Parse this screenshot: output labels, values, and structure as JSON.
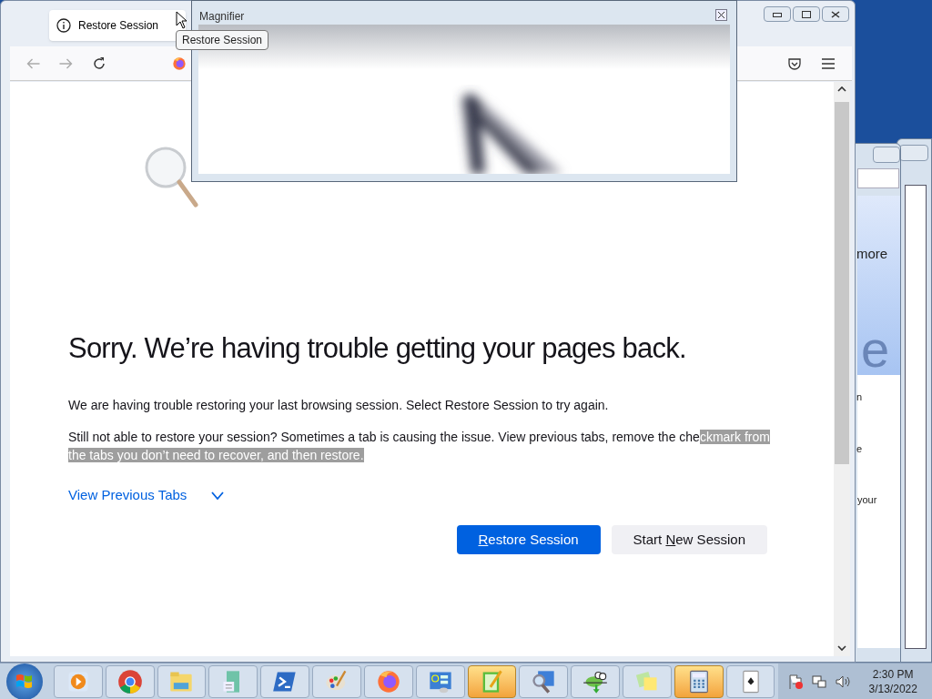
{
  "browser": {
    "tab": {
      "title": "Restore Session",
      "selected": true
    },
    "tooltip": "Restore Session",
    "page": {
      "heading": "Sorry. We’re having trouble getting your pages back.",
      "paragraphs": [
        {
          "text": "We are having trouble restoring your last browsing session. Select Restore Session to try again."
        },
        {
          "text": "Still not able to restore your session? Sometimes a tab is causing the issue. View previous tabs, remove the che",
          "selected_text": "ckmark from the tabs you don’t need to recover, and then restore."
        }
      ],
      "toggle": {
        "label": "View Previous Tabs",
        "expanded": false
      },
      "buttons": [
        {
          "access_key": "R",
          "rest": "estore Session",
          "primary": true
        },
        {
          "lead": "Start ",
          "access_key": "N",
          "rest": "ew Session",
          "primary": false
        }
      ]
    }
  },
  "magnifier": {
    "title": "Magnifier"
  },
  "back_windows": [
    {
      "texts": [
        "more",
        "e",
        "n",
        "e",
        "your"
      ]
    }
  ],
  "taskbar": {
    "items": [
      {
        "kind": "media",
        "active": false
      },
      {
        "kind": "chrome",
        "active": false
      },
      {
        "kind": "explorer",
        "active": false
      },
      {
        "kind": "document",
        "active": false
      },
      {
        "kind": "terminal",
        "active": false
      },
      {
        "kind": "paint",
        "active": false
      },
      {
        "kind": "firefox",
        "active": false
      },
      {
        "kind": "settings",
        "active": false
      },
      {
        "kind": "notepad",
        "active": true
      },
      {
        "kind": "magnifier",
        "active": false
      },
      {
        "kind": "chameleon",
        "active": false
      },
      {
        "kind": "notes",
        "active": false
      },
      {
        "kind": "calculator",
        "active": true
      },
      {
        "kind": "cards",
        "active": false
      }
    ],
    "time": "2:30 PM",
    "date": "3/13/2022"
  }
}
